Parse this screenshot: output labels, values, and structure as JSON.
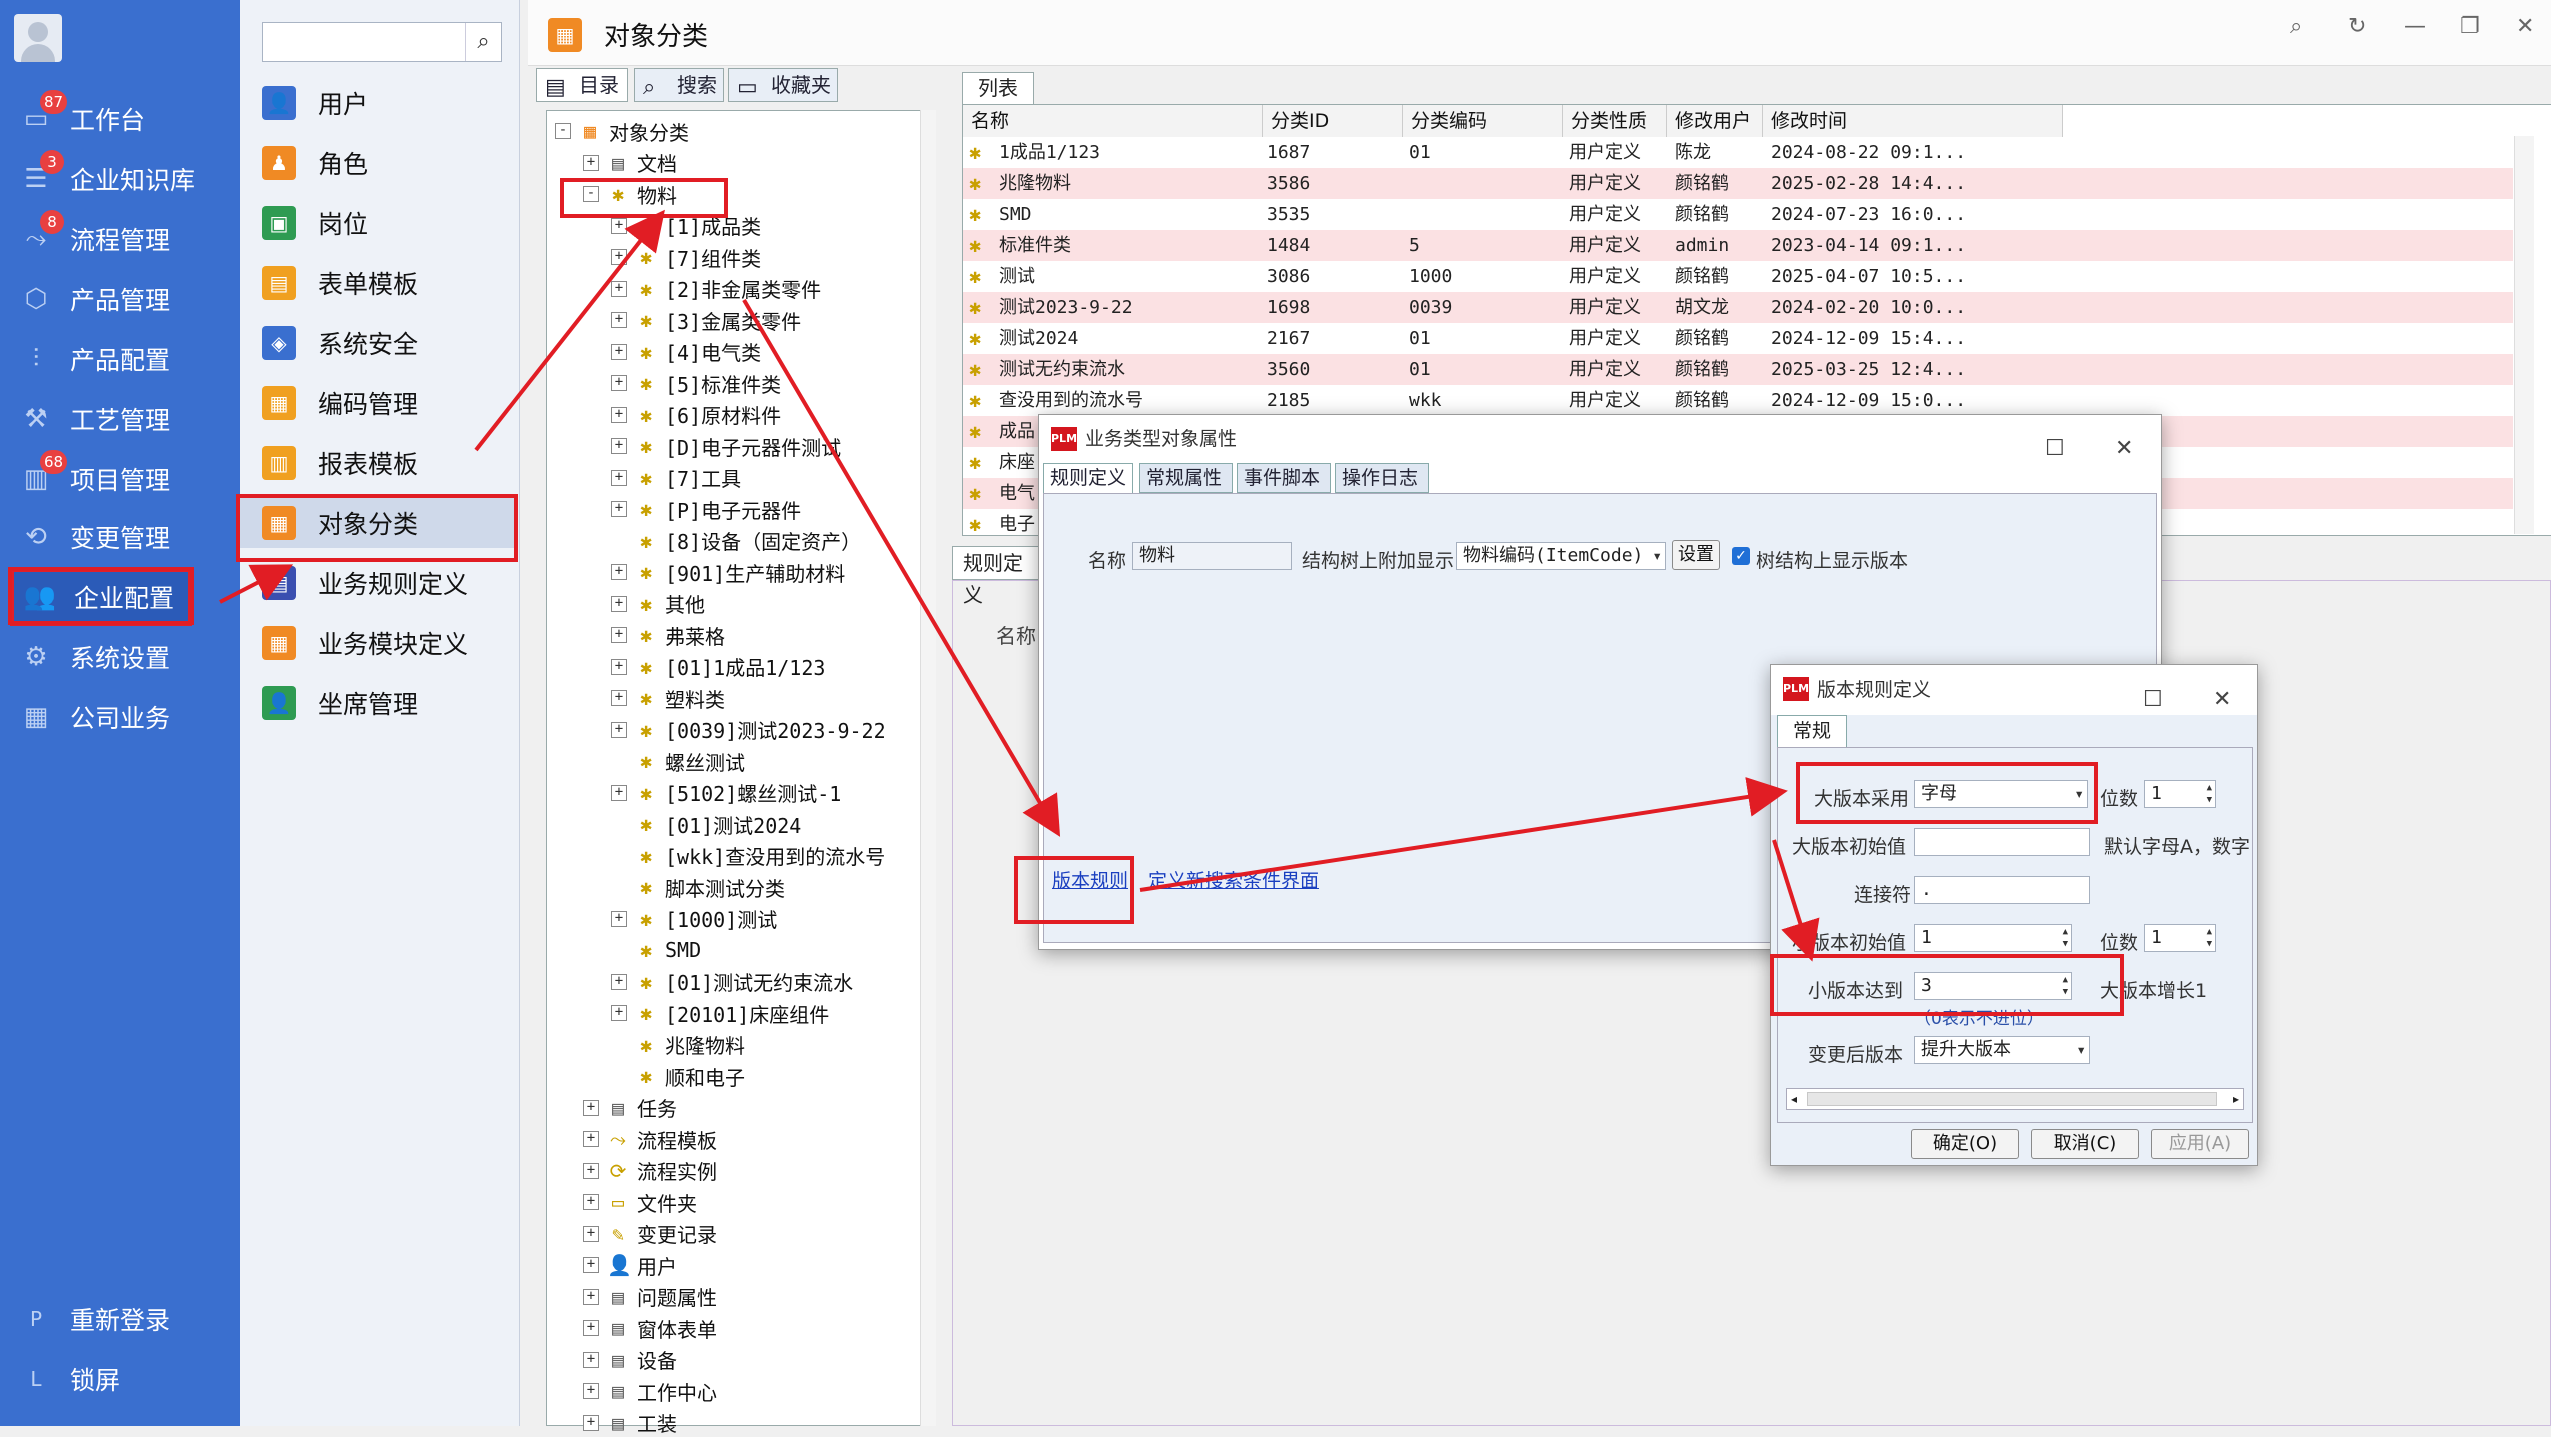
{
  "nav": {
    "items": [
      {
        "label": "工作台",
        "icon": "monitor-icon",
        "glyph": "▭",
        "badge": "87"
      },
      {
        "label": "企业知识库",
        "icon": "book-icon",
        "glyph": "☰",
        "badge": "3"
      },
      {
        "label": "流程管理",
        "icon": "flow-icon",
        "glyph": "⤳",
        "badge": "8"
      },
      {
        "label": "产品管理",
        "icon": "cube-icon",
        "glyph": "⬡",
        "badge": ""
      },
      {
        "label": "产品配置",
        "icon": "sliders-icon",
        "glyph": "⫶",
        "badge": ""
      },
      {
        "label": "工艺管理",
        "icon": "wrench-icon",
        "glyph": "⚒",
        "badge": ""
      },
      {
        "label": "项目管理",
        "icon": "chart-icon",
        "glyph": "▥",
        "badge": "68"
      },
      {
        "label": "变更管理",
        "icon": "change-icon",
        "glyph": "⟲",
        "badge": ""
      },
      {
        "label": "企业配置",
        "icon": "users-icon",
        "glyph": "👥",
        "badge": ""
      },
      {
        "label": "系统设置",
        "icon": "gear-icon",
        "glyph": "⚙",
        "badge": ""
      },
      {
        "label": "公司业务",
        "icon": "grid-icon",
        "glyph": "▦",
        "badge": ""
      }
    ],
    "relogin": {
      "key": "P",
      "label": "重新登录"
    },
    "lock": {
      "key": "L",
      "label": "锁屏"
    }
  },
  "sub": {
    "search_value": "",
    "items": [
      {
        "label": "用户",
        "color": "#3a6fcf",
        "glyph": "👤"
      },
      {
        "label": "角色",
        "color": "#f08a24",
        "glyph": "♟"
      },
      {
        "label": "岗位",
        "color": "#2e9b52",
        "glyph": "▣"
      },
      {
        "label": "表单模板",
        "color": "#f0a020",
        "glyph": "▤"
      },
      {
        "label": "系统安全",
        "color": "#3a6fcf",
        "glyph": "◈"
      },
      {
        "label": "编码管理",
        "color": "#f0a020",
        "glyph": "▦"
      },
      {
        "label": "报表模板",
        "color": "#f0a020",
        "glyph": "▥"
      },
      {
        "label": "对象分类",
        "color": "#f08a24",
        "glyph": "▦"
      },
      {
        "label": "业务规则定义",
        "color": "#3a4fb0",
        "glyph": "▤"
      },
      {
        "label": "业务模块定义",
        "color": "#f08a24",
        "glyph": "▦"
      },
      {
        "label": "坐席管理",
        "color": "#2e9b52",
        "glyph": "👤"
      }
    ]
  },
  "main": {
    "title": "对象分类"
  },
  "pane_tabs": {
    "dir": "目录",
    "search": "搜索",
    "fav": "收藏夹"
  },
  "tree": [
    {
      "t": "对象分类",
      "lv": 0,
      "pm": "-",
      "ic": "▦"
    },
    {
      "t": "文档",
      "lv": 1,
      "pm": "+",
      "ic": "▤"
    },
    {
      "t": "物料",
      "lv": 1,
      "pm": "-",
      "ic": "✱"
    },
    {
      "t": "[1]成品类",
      "lv": 2,
      "pm": "+",
      "ic": "✱"
    },
    {
      "t": "[7]组件类",
      "lv": 2,
      "pm": "+",
      "ic": "✱"
    },
    {
      "t": "[2]非金属类零件",
      "lv": 2,
      "pm": "+",
      "ic": "✱"
    },
    {
      "t": "[3]金属类零件",
      "lv": 2,
      "pm": "+",
      "ic": "✱"
    },
    {
      "t": "[4]电气类",
      "lv": 2,
      "pm": "+",
      "ic": "✱"
    },
    {
      "t": "[5]标准件类",
      "lv": 2,
      "pm": "+",
      "ic": "✱"
    },
    {
      "t": "[6]原材料件",
      "lv": 2,
      "pm": "+",
      "ic": "✱"
    },
    {
      "t": "[D]电子元器件测试",
      "lv": 2,
      "pm": "+",
      "ic": "✱"
    },
    {
      "t": "[7]工具",
      "lv": 2,
      "pm": "+",
      "ic": "✱"
    },
    {
      "t": "[P]电子元器件",
      "lv": 2,
      "pm": "+",
      "ic": "✱"
    },
    {
      "t": "[8]设备（固定资产）",
      "lv": 2,
      "pm": "",
      "ic": "✱"
    },
    {
      "t": "[901]生产辅助材料",
      "lv": 2,
      "pm": "+",
      "ic": "✱"
    },
    {
      "t": "其他",
      "lv": 2,
      "pm": "+",
      "ic": "✱"
    },
    {
      "t": "弗莱格",
      "lv": 2,
      "pm": "+",
      "ic": "✱"
    },
    {
      "t": "[01]1成品1/123",
      "lv": 2,
      "pm": "+",
      "ic": "✱"
    },
    {
      "t": "塑料类",
      "lv": 2,
      "pm": "+",
      "ic": "✱"
    },
    {
      "t": "[0039]测试2023-9-22",
      "lv": 2,
      "pm": "+",
      "ic": "✱"
    },
    {
      "t": "螺丝测试",
      "lv": 2,
      "pm": "",
      "ic": "✱"
    },
    {
      "t": "[5102]螺丝测试-1",
      "lv": 2,
      "pm": "+",
      "ic": "✱"
    },
    {
      "t": "[01]测试2024",
      "lv": 2,
      "pm": "",
      "ic": "✱"
    },
    {
      "t": "[wkk]查没用到的流水号",
      "lv": 2,
      "pm": "",
      "ic": "✱"
    },
    {
      "t": "脚本测试分类",
      "lv": 2,
      "pm": "",
      "ic": "✱"
    },
    {
      "t": "[1000]测试",
      "lv": 2,
      "pm": "+",
      "ic": "✱"
    },
    {
      "t": "SMD",
      "lv": 2,
      "pm": "",
      "ic": "✱"
    },
    {
      "t": "[01]测试无约束流水",
      "lv": 2,
      "pm": "+",
      "ic": "✱"
    },
    {
      "t": "[20101]床座组件",
      "lv": 2,
      "pm": "+",
      "ic": "✱"
    },
    {
      "t": "兆隆物料",
      "lv": 2,
      "pm": "",
      "ic": "✱"
    },
    {
      "t": "顺和电子",
      "lv": 2,
      "pm": "",
      "ic": "✱"
    },
    {
      "t": "任务",
      "lv": 1,
      "pm": "+",
      "ic": "▤"
    },
    {
      "t": "流程模板",
      "lv": 1,
      "pm": "+",
      "ic": "⤳"
    },
    {
      "t": "流程实例",
      "lv": 1,
      "pm": "+",
      "ic": "⟳"
    },
    {
      "t": "文件夹",
      "lv": 1,
      "pm": "+",
      "ic": "▭"
    },
    {
      "t": "变更记录",
      "lv": 1,
      "pm": "+",
      "ic": "✎"
    },
    {
      "t": "用户",
      "lv": 1,
      "pm": "+",
      "ic": "👤"
    },
    {
      "t": "问题属性",
      "lv": 1,
      "pm": "+",
      "ic": "▤"
    },
    {
      "t": "窗体表单",
      "lv": 1,
      "pm": "+",
      "ic": "▤"
    },
    {
      "t": "设备",
      "lv": 1,
      "pm": "+",
      "ic": "▤"
    },
    {
      "t": "工作中心",
      "lv": 1,
      "pm": "+",
      "ic": "▤"
    },
    {
      "t": "工装",
      "lv": 1,
      "pm": "+",
      "ic": "▤"
    }
  ],
  "grid": {
    "tab": "列表",
    "columns": [
      "名称",
      "分类ID",
      "分类编码",
      "分类性质",
      "修改用户",
      "修改时间"
    ],
    "rows": [
      [
        "1成品1/123",
        "1687",
        "01",
        "用户定义",
        "陈龙",
        "2024-08-22 09:1..."
      ],
      [
        "兆隆物料",
        "3586",
        "",
        "用户定义",
        "颜铭鹤",
        "2025-02-28 14:4..."
      ],
      [
        "SMD",
        "3535",
        "",
        "用户定义",
        "颜铭鹤",
        "2024-07-23 16:0..."
      ],
      [
        "标准件类",
        "1484",
        "5",
        "用户定义",
        "admin",
        "2023-04-14 09:1..."
      ],
      [
        "测试",
        "3086",
        "1000",
        "用户定义",
        "颜铭鹤",
        "2025-04-07 10:5..."
      ],
      [
        "测试2023-9-22",
        "1698",
        "0039",
        "用户定义",
        "胡文龙",
        "2024-02-20 10:0..."
      ],
      [
        "测试2024",
        "2167",
        "01",
        "用户定义",
        "颜铭鹤",
        "2024-12-09 15:4..."
      ],
      [
        "测试无约束流水",
        "3560",
        "01",
        "用户定义",
        "颜铭鹤",
        "2025-03-25 12:4..."
      ],
      [
        "查没用到的流水号",
        "2185",
        "wkk",
        "用户定义",
        "颜铭鹤",
        "2024-12-09 15:0..."
      ],
      [
        "成品",
        "",
        "",
        "",
        "",
        ""
      ],
      [
        "床座",
        "",
        "",
        "",
        "",
        ""
      ],
      [
        "电气",
        "",
        "",
        "",
        "",
        ""
      ],
      [
        "电子",
        "",
        "",
        "",
        "",
        ""
      ]
    ]
  },
  "lower": {
    "tab": "规则定义",
    "name_label": "名称"
  },
  "dlg1": {
    "title": "业务类型对象属性",
    "tabs": [
      "规则定义",
      "常规属性",
      "事件脚本",
      "操作日志"
    ],
    "name_label": "名称",
    "name_value": "物料",
    "struct_label": "结构树上附加显示",
    "struct_value": "物料编码(ItemCode)",
    "set_btn": "设置",
    "show_ver_label": "树结构上显示版本",
    "link_version": "版本规则",
    "link_search": "定义新搜索条件界面"
  },
  "dlg2": {
    "title": "版本规则定义",
    "tab": "常规",
    "major_use_label": "大版本采用",
    "major_use_value": "字母",
    "digits_label": "位数",
    "major_digits": "1",
    "major_init_label": "大版本初始值",
    "major_init_value": "",
    "major_hint": "默认字母A，数字",
    "sep_label": "连接符",
    "sep_value": ".",
    "minor_init_label": "小版本初始值",
    "minor_init_value": "1",
    "minor_digits": "1",
    "minor_reach_label": "小版本达到",
    "minor_reach_value": "3",
    "minor_reach_hint": "大版本增长1",
    "zero_hint": "（0表示不进位）",
    "after_change_label": "变更后版本",
    "after_change_value": "提升大版本",
    "ok": "确定(O)",
    "cancel": "取消(C)",
    "apply": "应用(A)"
  }
}
